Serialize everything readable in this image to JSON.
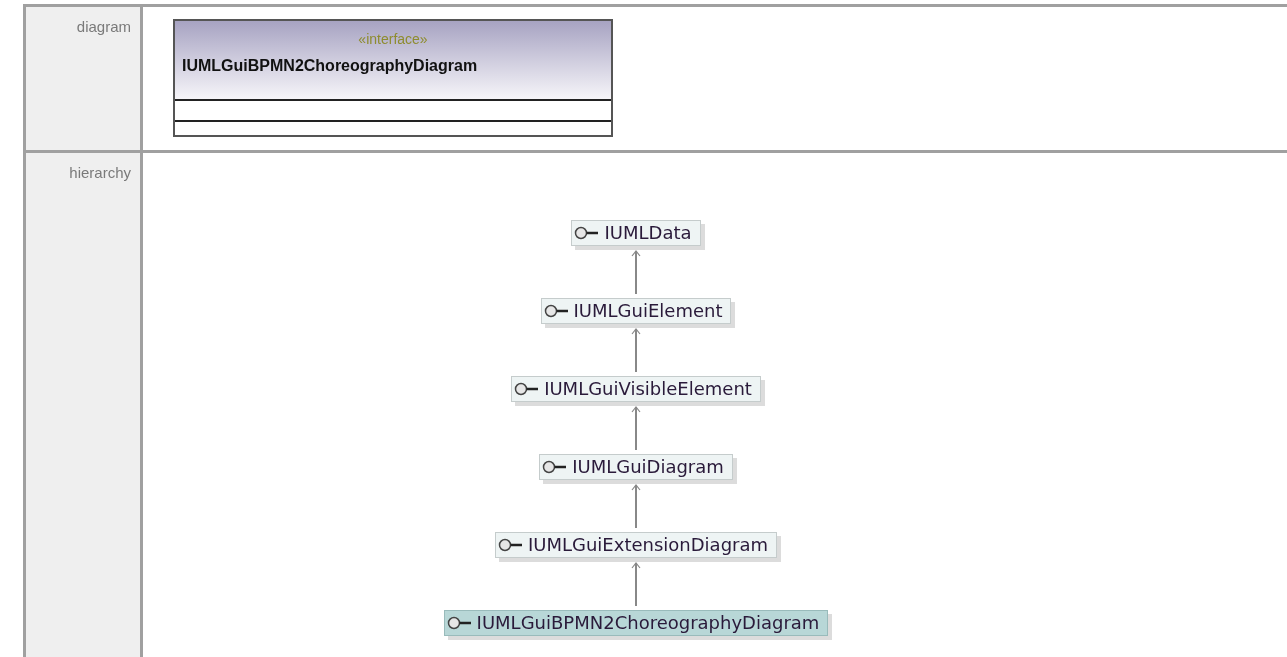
{
  "rows": [
    {
      "label": "diagram",
      "kind": "class_box",
      "stereotype": "«interface»",
      "name": "IUMLGuiBPMN2ChoreographyDiagram"
    },
    {
      "label": "hierarchy",
      "kind": "hierarchy",
      "nodes": [
        {
          "name": "IUMLData",
          "selected": false
        },
        {
          "name": "IUMLGuiElement",
          "selected": false
        },
        {
          "name": "IUMLGuiVisibleElement",
          "selected": false
        },
        {
          "name": "IUMLGuiDiagram",
          "selected": false
        },
        {
          "name": "IUMLGuiExtensionDiagram",
          "selected": false
        },
        {
          "name": "IUMLGuiBPMN2ChoreographyDiagram",
          "selected": true
        }
      ]
    }
  ]
}
